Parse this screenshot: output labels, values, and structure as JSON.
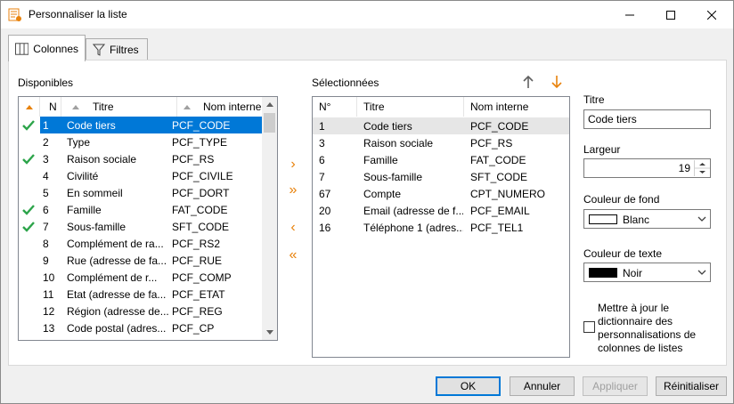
{
  "window": {
    "title": "Personnaliser la liste"
  },
  "tabs": [
    {
      "label": "Colonnes",
      "active": true,
      "icon": "columns-icon"
    },
    {
      "label": "Filtres",
      "active": false,
      "icon": "filter-icon"
    }
  ],
  "disponibles": {
    "label": "Disponibles",
    "headers": {
      "n": "N",
      "titre": "Titre",
      "nom": "Nom interne"
    },
    "rows": [
      {
        "n": "1",
        "titre": "Code tiers",
        "nom": "PCF_CODE",
        "checked": true,
        "selected": true
      },
      {
        "n": "2",
        "titre": "Type",
        "nom": "PCF_TYPE",
        "checked": false,
        "selected": false
      },
      {
        "n": "3",
        "titre": "Raison sociale",
        "nom": "PCF_RS",
        "checked": true,
        "selected": false
      },
      {
        "n": "4",
        "titre": "Civilité",
        "nom": "PCF_CIVILE",
        "checked": false,
        "selected": false
      },
      {
        "n": "5",
        "titre": "En sommeil",
        "nom": "PCF_DORT",
        "checked": false,
        "selected": false
      },
      {
        "n": "6",
        "titre": "Famille",
        "nom": "FAT_CODE",
        "checked": true,
        "selected": false
      },
      {
        "n": "7",
        "titre": "Sous-famille",
        "nom": "SFT_CODE",
        "checked": true,
        "selected": false
      },
      {
        "n": "8",
        "titre": "Complément de ra...",
        "nom": "PCF_RS2",
        "checked": false,
        "selected": false
      },
      {
        "n": "9",
        "titre": "Rue (adresse de fa...",
        "nom": "PCF_RUE",
        "checked": false,
        "selected": false
      },
      {
        "n": "10",
        "titre": "Complément de r...",
        "nom": "PCF_COMP",
        "checked": false,
        "selected": false
      },
      {
        "n": "11",
        "titre": "Etat (adresse de fa...",
        "nom": "PCF_ETAT",
        "checked": false,
        "selected": false
      },
      {
        "n": "12",
        "titre": "Région (adresse de...",
        "nom": "PCF_REG",
        "checked": false,
        "selected": false
      },
      {
        "n": "13",
        "titre": "Code postal (adres...",
        "nom": "PCF_CP",
        "checked": false,
        "selected": false
      }
    ]
  },
  "selectionnees": {
    "label": "Sélectionnées",
    "headers": {
      "n": "N°",
      "titre": "Titre",
      "nom": "Nom interne"
    },
    "rows": [
      {
        "n": "1",
        "titre": "Code tiers",
        "nom": "PCF_CODE",
        "highlighted": true
      },
      {
        "n": "3",
        "titre": "Raison sociale",
        "nom": "PCF_RS",
        "highlighted": false
      },
      {
        "n": "6",
        "titre": "Famille",
        "nom": "FAT_CODE",
        "highlighted": false
      },
      {
        "n": "7",
        "titre": "Sous-famille",
        "nom": "SFT_CODE",
        "highlighted": false
      },
      {
        "n": "67",
        "titre": "Compte",
        "nom": "CPT_NUMERO",
        "highlighted": false
      },
      {
        "n": "20",
        "titre": "Email (adresse de f...",
        "nom": "PCF_EMAIL",
        "highlighted": false
      },
      {
        "n": "16",
        "titre": "Téléphone 1 (adres...",
        "nom": "PCF_TEL1",
        "highlighted": false
      }
    ]
  },
  "transfer": {
    "add": "›",
    "add_all": "»",
    "remove": "‹",
    "remove_all": "«"
  },
  "props": {
    "titre_label": "Titre",
    "titre_value": "Code tiers",
    "largeur_label": "Largeur",
    "largeur_value": "19",
    "fond_label": "Couleur de fond",
    "fond_value": "Blanc",
    "fond_color": "#ffffff",
    "texte_label": "Couleur de texte",
    "texte_value": "Noir",
    "texte_color": "#000000",
    "dict_label": "Mettre à jour le dictionnaire des personnalisations de colonnes de listes",
    "dict_checked": false
  },
  "buttons": {
    "ok": "OK",
    "annuler": "Annuler",
    "appliquer": "Appliquer",
    "reinitialiser": "Réinitialiser"
  },
  "colors": {
    "accent": "#0078d7",
    "orange": "#e8820c",
    "check": "#2ca44a"
  }
}
